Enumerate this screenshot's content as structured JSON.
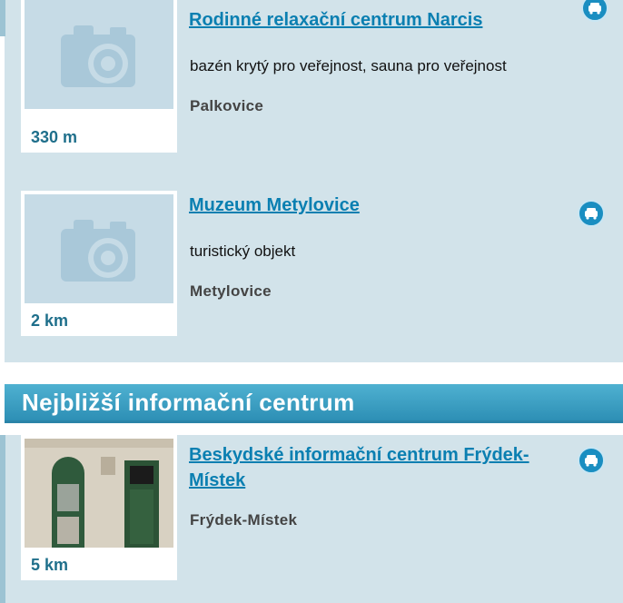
{
  "items": [
    {
      "title": "Rodinné relaxační centrum Narcis",
      "description": "bazén krytý pro veřejnost, sauna pro veřejnost",
      "place": "Palkovice",
      "distance": "330 m",
      "icon": "car-icon"
    },
    {
      "title": "Muzeum Metylovice",
      "description": "turistický objekt",
      "place": "Metylovice",
      "distance": "2 km",
      "icon": "car-icon"
    }
  ],
  "info_section": {
    "heading": "Nejbližší informační centrum",
    "item": {
      "title": "Beskydské informační centrum Frýdek-Místek",
      "place": "Frýdek-Místek",
      "distance": "5 km",
      "icon": "car-icon"
    }
  },
  "colors": {
    "panel": "#d2e3ea",
    "header": "#3a9dc3",
    "link": "#0a7fb1",
    "distance": "#1f6f8b"
  }
}
